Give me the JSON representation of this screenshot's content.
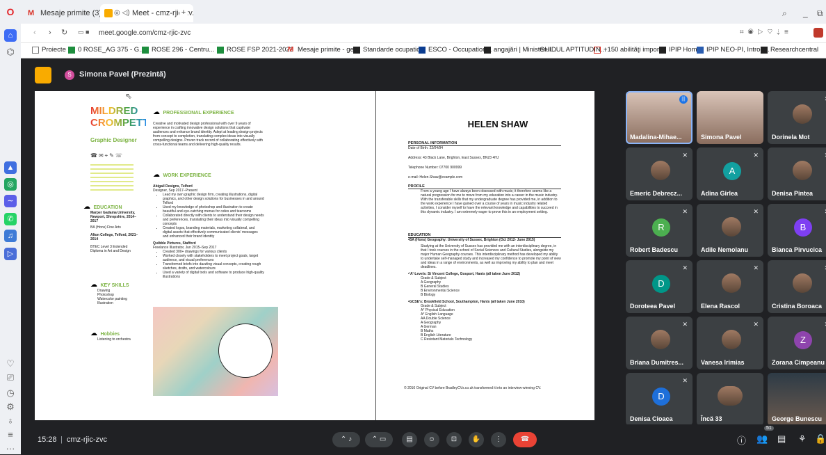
{
  "browser": {
    "tabs": [
      {
        "label": "Mesaje primite (3) - georg..."
      },
      {
        "label": "Meet - cmz-rjic-zv..."
      }
    ],
    "url": "meet.google.com/cmz-rjic-zvc",
    "bookmarks": [
      "Proiecte",
      "0 ROSE_AG 375 - G...",
      "ROSE 296 - Centru...",
      "ROSE FSP 2021-2022",
      "Mesaje primite - ge...",
      "Standarde ocupatio...",
      "ESCO - Occupation...",
      "angajări | Ministerul...",
      "GHIDUL APTITUDIN...",
      "+150 abilităţi impor...",
      "IPIP Home",
      "IPIP NEO-PI, Introd...",
      "Researchcentral"
    ]
  },
  "meet": {
    "presenter_initial": "S",
    "presenter_label": "Simona Pavel (Prezintă)",
    "time": "15:28",
    "meeting_code": "cmz-rjic-zvc",
    "participants_count": "51",
    "colors": {
      "accent_blue": "#8ab4f8",
      "end_call": "#ea4335",
      "tile_bg": "#3c4043"
    }
  },
  "cv_left": {
    "name_line1": "MILDRED",
    "name_line2": "CROMPETT",
    "role": "Graphic Designer",
    "sec_prof": "PROFESSIONAL EXPERIENCE",
    "prof_text": "Creative and motivated design professional with over 9 years of experience in crafting innovative design solutions that captivate audiences and enhance brand identity. Adept at leading design projects from concept to completion, translating complex ideas into visually compelling designs. Proven track record of collaborating effectively with cross-functional teams and delivering high-quality results.",
    "sec_work": "WORK EXPERIENCE",
    "job1_title": "Abigail Designs, Telford",
    "job1_sub": "Designer, Sep 2017–Present",
    "job1_bullets": [
      "Lead my own graphic design firm, creating illustrations, digital graphics, and other design solutions for businesses in and around Telford",
      "Used my knowledge of photoshop and illustration to create beautiful and eye-catching menus for cafes and tearooms",
      "Collaborated directly with clients to understand their design needs and preferences, translating their ideas into visually compelling concepts",
      "Created logos, branding materials, marketing collateral, and digital assets that effectively communicated clients' messages and enhanced their brand identity"
    ],
    "job2_title": "Quibble Pictures, Stafford",
    "job2_sub": "Freelance Illustrator, Jun 2015–Sep 2017",
    "job2_bullets": [
      "Created 300+ drawings for various clients",
      "Worked closely with stakeholders to meet project goals, target audience, and visual preferences",
      "Transformed briefs into dazzling visual concepts, creating rough sketches, drafts, and watercolours",
      "Used a variety of digital tools and software to produce high-quality illustrations"
    ],
    "sec_edu": "EDUCATION",
    "edu": [
      "Marper Gadama University, Newport, Shropshire, 2014–2017",
      "BA (Hons) Fine Arts",
      "Alton College, Telford, 2021–2014",
      "BTEC Level 3 Extended Diploma in Art and Design"
    ],
    "sec_skills": "KEY SKILLS",
    "skills": [
      "Drawing",
      "Photoshop",
      "Watercolor painting",
      "Illustration"
    ],
    "sec_hobbies": "Hobbies",
    "hobbies": [
      "Listening to orchestra"
    ]
  },
  "cv_right": {
    "name": "HELEN SHAW",
    "sec_personal": "PERSONAL INFORMATION",
    "dob": "Date of Birth: 22/04/94",
    "address": "Address: 43 Black Lane, Brighton, East Sussex, BN23 4HJ",
    "phone": "Telephone Number: 07700 900999",
    "email": "e-mail: Helen.Shaw@example.com",
    "sec_profile": "PROFILE",
    "profile_text": "From a young age I have always been obsessed with music; it therefore seems like a natural progression for me to move from my education into a career in the music industry. With the transferable skills that my undergraduate degree has provided me, in addition to the work experience I have gained over a course of years in music industry related activities, I consider myself to have the relevant knowledge and capabilities to succeed in this dynamic industry. I am extremely eager to prove this in an employment setting.",
    "sec_education": "EDUCATION",
    "edu1": "•BA (Hons) Geography: University of Sussex, Brighton (Oct 2012- June 2015)",
    "edu1_text": "Studying at the University of Sussex has provided me with an interdisciplinary degree, in that I took courses in the school of Social Sciences and Cultural Studies, alongside my major Human Geography courses. This interdisciplinary method has developed my ability to undertake self-managed study and increased my confidence to promote my point of view and ideas in a range of environments, as well as improving my ability to plan and meet deadlines.",
    "alevels": "•'A'-Levels: St Vincent College, Gosport, Hants (all taken June 2012)",
    "alevels_grades": [
      "Grade & Subject",
      "A Geography",
      "B General Studies",
      "B Environmental Science",
      "B Biology"
    ],
    "gcse": "•GCSE's: Brookfield School, Southampton, Hants (all taken June 2010)",
    "gcse_grades": [
      "Grade & Subject",
      "A* Physical Education",
      "A* English Language",
      "AA Double Science",
      "A Geography",
      "A German",
      "B Maths",
      "B English Literature",
      "C Resistant Materials Technology"
    ],
    "footer": "© 2016 Original CV before BradleyCVs.co.uk transformed it into an interview-winning CV."
  },
  "participants": [
    {
      "name": "Madalina-Mihae...",
      "type": "photo",
      "muted": false,
      "speaking": true
    },
    {
      "name": "Simona Pavel",
      "type": "photo",
      "muted": false
    },
    {
      "name": "Dorinela Mot",
      "type": "photo",
      "muted": true
    },
    {
      "name": "Emeric Debrecz...",
      "type": "photo",
      "muted": true
    },
    {
      "name": "Adina Girlea",
      "type": "letter",
      "initial": "A",
      "color": "#12a0a0",
      "muted": true
    },
    {
      "name": "Denisa Pintea",
      "type": "photo",
      "muted": true
    },
    {
      "name": "Robert Badescu",
      "type": "letter",
      "initial": "R",
      "color": "#4caf50",
      "muted": true
    },
    {
      "name": "Adile Nemolanu",
      "type": "photo",
      "muted": true
    },
    {
      "name": "Bianca Pirvucica",
      "type": "letter",
      "initial": "B",
      "color": "#7e3ff2",
      "muted": true
    },
    {
      "name": "Doroteea Pavel",
      "type": "letter",
      "initial": "D",
      "color": "#009688",
      "muted": true
    },
    {
      "name": "Elena Rascol",
      "type": "photo",
      "muted": true
    },
    {
      "name": "Cristina Boroaca",
      "type": "photo",
      "muted": true
    },
    {
      "name": "Briana Dumitres...",
      "type": "photo",
      "muted": true
    },
    {
      "name": "Vanesa Irimias",
      "type": "photo",
      "muted": true
    },
    {
      "name": "Zorana Cimpeanu",
      "type": "letter",
      "initial": "Z",
      "color": "#8e44ad",
      "muted": true
    },
    {
      "name": "Denisa Cioaca",
      "type": "letter",
      "initial": "D",
      "color": "#1e6fd9",
      "muted": true
    },
    {
      "name": "Încă 33",
      "type": "more",
      "muted": false
    },
    {
      "name": "George Bunescu",
      "type": "photo",
      "muted": false
    }
  ]
}
